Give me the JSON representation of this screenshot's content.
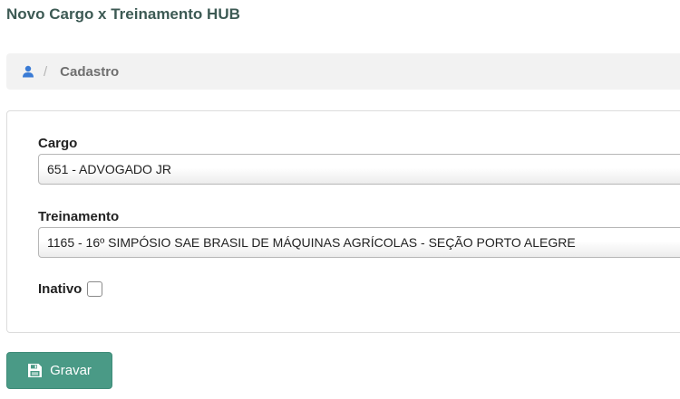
{
  "page": {
    "title": "Novo Cargo x Treinamento HUB"
  },
  "breadcrumb": {
    "icon": "user-icon",
    "separator": "/",
    "current": "Cadastro"
  },
  "form": {
    "cargo": {
      "label": "Cargo",
      "value": "651 - ADVOGADO JR"
    },
    "treinamento": {
      "label": "Treinamento",
      "value": "1165 - 16º SIMPÓSIO SAE BRASIL DE MÁQUINAS AGRÍCOLAS - SEÇÃO PORTO ALEGRE"
    },
    "inativo": {
      "label": "Inativo",
      "checked": false
    }
  },
  "actions": {
    "save_label": "Gravar",
    "save_icon": "save-icon"
  },
  "colors": {
    "title": "#3d5a54",
    "accent": "#4a9a86",
    "breadcrumb_bg": "#f2f2f2",
    "user_icon": "#3a7bd5"
  }
}
